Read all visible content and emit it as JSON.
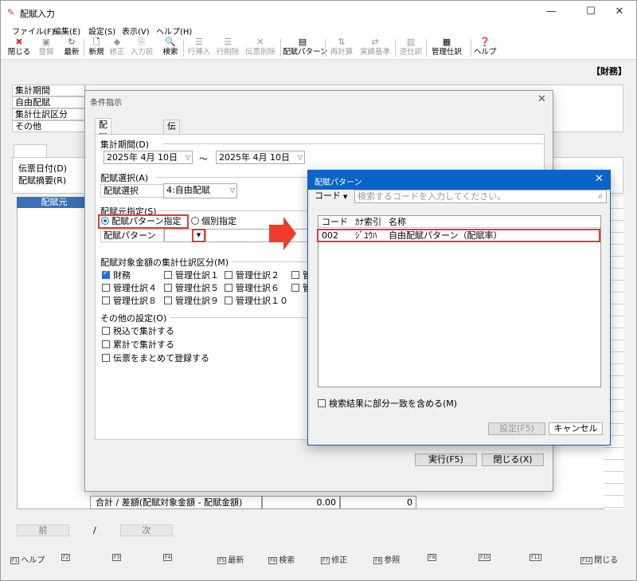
{
  "window": {
    "title": "配賦入力",
    "controls": {
      "minimize": "—",
      "maximize": "☐",
      "close": "✕"
    }
  },
  "menu": [
    "ファイル(F)",
    "編集(E)",
    "設定(S)",
    "表示(V)",
    "ヘルプ(H)"
  ],
  "toolbar": {
    "close": "閉じる",
    "register": "登録",
    "refresh": "最新",
    "new": "新規",
    "edit": "修正",
    "prev_input": "入力前",
    "search": "検索",
    "row_insert": "行挿入",
    "row_delete": "行削除",
    "slip_delete": "伝票削除",
    "pattern": "配賦パターン",
    "recalc": "再計算",
    "actual_base": "実績基準",
    "reverse": "逆仕訳",
    "mgmt_journal": "管理仕訳",
    "help": "ヘルプ"
  },
  "book_label": "【財務】",
  "main": {
    "fields": [
      "集計期間",
      "自由配賦",
      "集計仕訳区分",
      "その他"
    ],
    "slip_fields": [
      "伝票日付(D)",
      "配賦摘要(R)"
    ],
    "col_header": "配賦元",
    "nav": {
      "prev": "前",
      "sep": "/",
      "next": "次"
    }
  },
  "fkeys": [
    {
      "key": "F1",
      "label": "ヘルプ"
    },
    {
      "key": "F2",
      "label": ""
    },
    {
      "key": "F3",
      "label": ""
    },
    {
      "key": "F4",
      "label": ""
    },
    {
      "key": "F5",
      "label": "最新"
    },
    {
      "key": "F6",
      "label": "検索"
    },
    {
      "key": "F7",
      "label": "修正"
    },
    {
      "key": "F8",
      "label": "参照"
    },
    {
      "key": "F9",
      "label": ""
    },
    {
      "key": "F10",
      "label": ""
    },
    {
      "key": "F11",
      "label": ""
    },
    {
      "key": "F12",
      "label": "閉じる"
    }
  ],
  "cond_dialog": {
    "title": "条件指示",
    "tabs": [
      "配賦元集計条件",
      "伝票検索"
    ],
    "period_label": "集計期間(D)",
    "date_from": "2025年  4月 10日",
    "date_sep": "～",
    "date_to": "2025年  4月 10日",
    "alloc_select_label": "配賦選択(A)",
    "alloc_select_field": "配賦選択",
    "alloc_select_value": "4:自由配賦",
    "source_label": "配賦元指定(S)",
    "radio_pattern": "配賦パターン指定",
    "radio_individual": "個別指定",
    "pattern_field": "配賦パターン",
    "amount_label": "配賦対象金額の集計仕訳区分(M)",
    "checkboxes": [
      {
        "label": "財務",
        "checked": true
      },
      {
        "label": "管理仕訳１",
        "checked": false
      },
      {
        "label": "管理仕訳２",
        "checked": false
      },
      {
        "label": "管",
        "checked": false
      },
      {
        "label": "管理仕訳４",
        "checked": false
      },
      {
        "label": "管理仕訳５",
        "checked": false
      },
      {
        "label": "管理仕訳６",
        "checked": false
      },
      {
        "label": "管",
        "checked": false
      },
      {
        "label": "管理仕訳８",
        "checked": false
      },
      {
        "label": "管理仕訳９",
        "checked": false
      },
      {
        "label": "管理仕訳１０",
        "checked": false
      }
    ],
    "other_label": "その他の設定(O)",
    "other_options": [
      "税込で集計する",
      "累計で集計する",
      "伝票をまとめて登録する"
    ],
    "execute": "実行(F5)",
    "close": "閉じる(X)"
  },
  "totals": {
    "label": "合計 / 差額(配賦対象金額 - 配賦金額)",
    "value1": "0.00",
    "value2": "0"
  },
  "pattern_dialog": {
    "title": "配賦パターン",
    "search_mode": "コード",
    "search_placeholder": "検索するコードを入力してください。",
    "columns": [
      "コード",
      "ｶﾅ索引",
      "名称"
    ],
    "rows": [
      {
        "code": "002",
        "kana": "ｼﾞﾕｳﾊ",
        "name": "自由配賦パターン（配賦率）"
      }
    ],
    "partial_match": "検索結果に部分一致を含める(M)",
    "ok": "設定(F5)",
    "cancel": "キャンセル"
  },
  "colors": {
    "accent": "#0a64c8",
    "highlight": "#e53935",
    "arrow": "#f03c2a"
  }
}
